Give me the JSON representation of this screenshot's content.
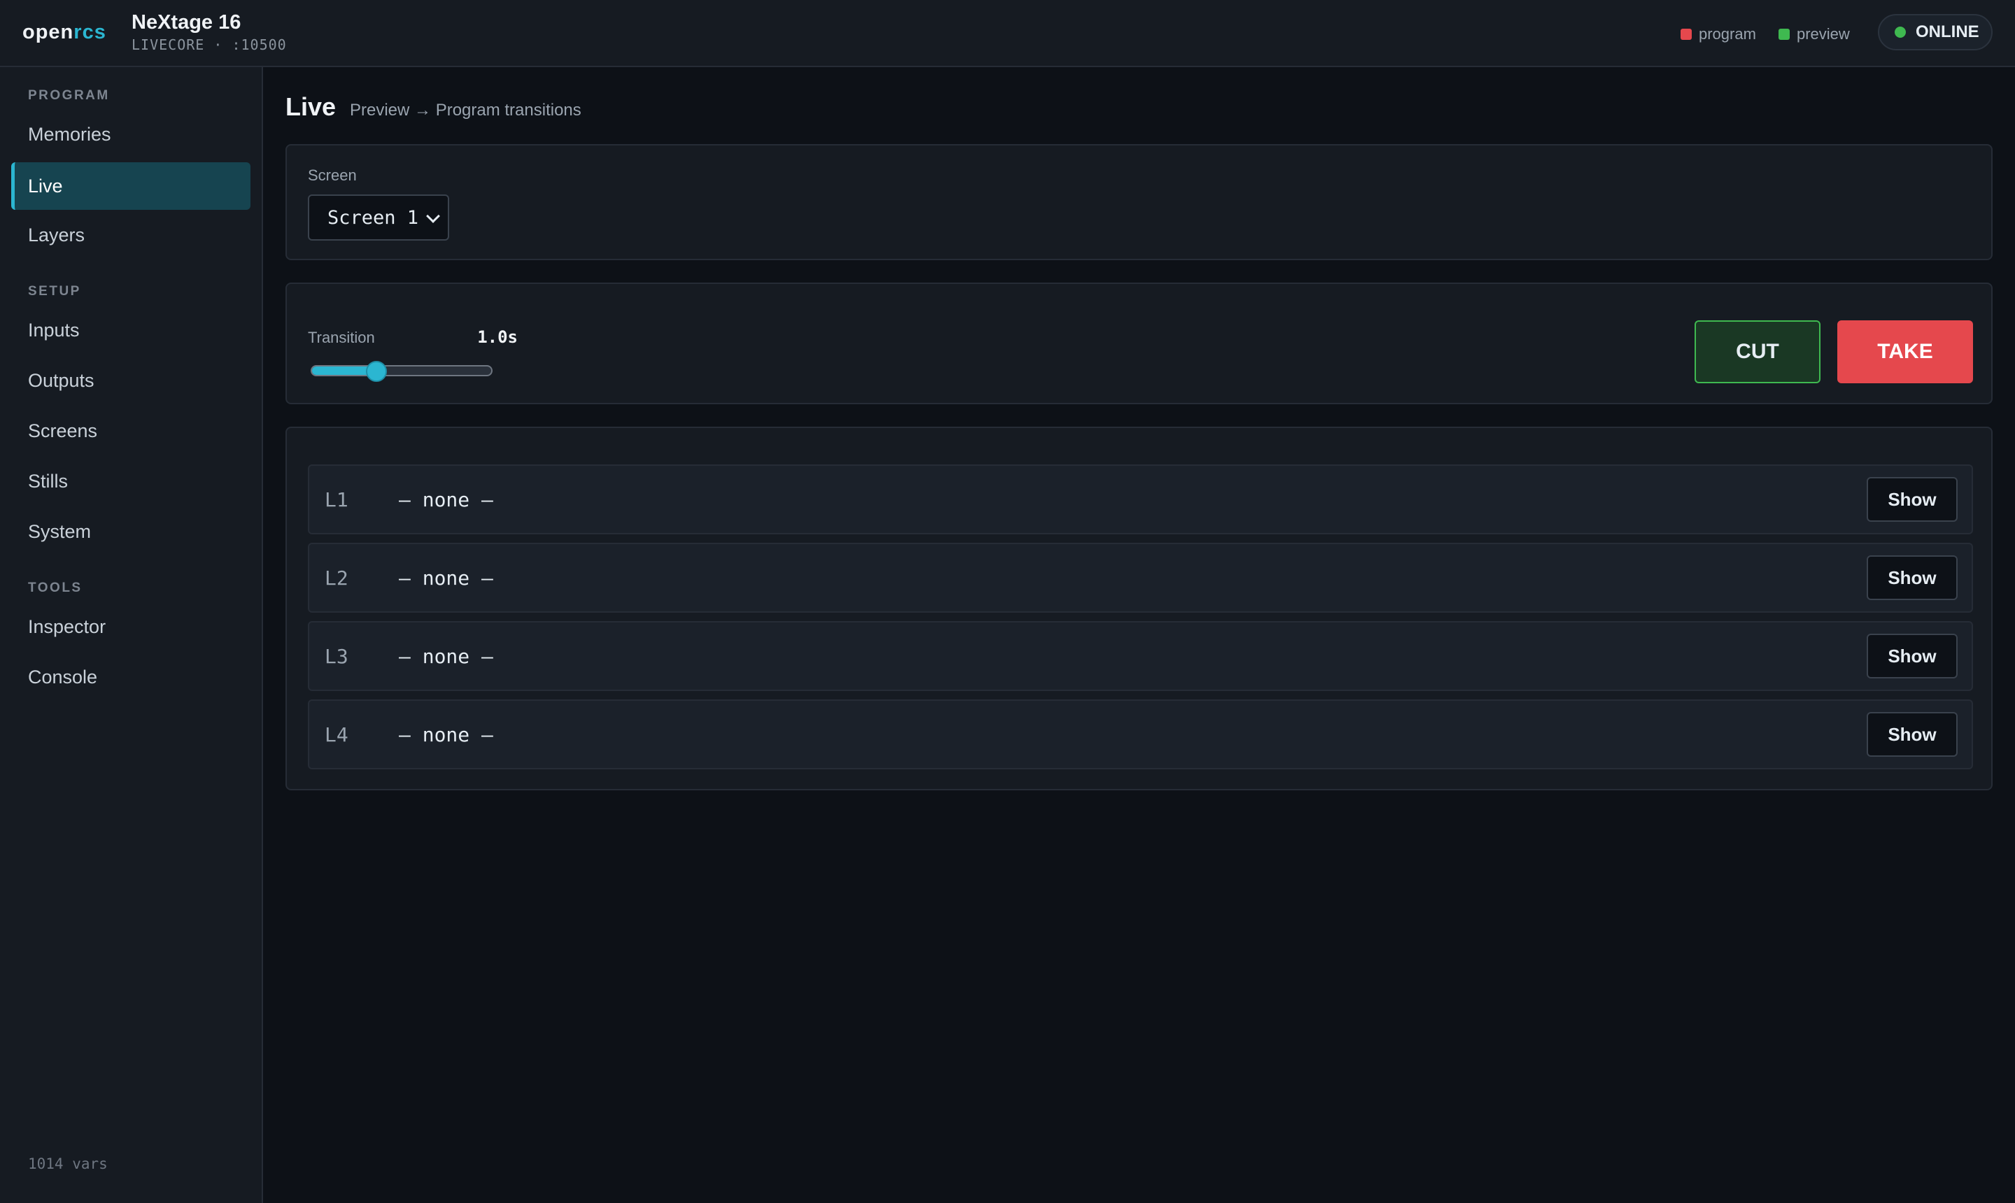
{
  "brand": {
    "part1": "open",
    "part2": "rcs"
  },
  "device": {
    "name": "NeXtage 16",
    "sub": "LIVECORE · :10500"
  },
  "legend": {
    "program": {
      "label": "program",
      "color": "#e5484d"
    },
    "preview": {
      "label": "preview",
      "color": "#3fb950"
    }
  },
  "status": {
    "label": "ONLINE",
    "color": "#3fb950"
  },
  "sidebar": {
    "sections": [
      {
        "label": "PROGRAM",
        "items": [
          "Memories",
          "Live",
          "Layers"
        ]
      },
      {
        "label": "SETUP",
        "items": [
          "Inputs",
          "Outputs",
          "Screens",
          "Stills",
          "System"
        ]
      },
      {
        "label": "TOOLS",
        "items": [
          "Inspector",
          "Console"
        ]
      }
    ],
    "active": "Live",
    "footer": "1014 vars"
  },
  "page": {
    "title": "Live",
    "subtitle": "Preview → Program transitions"
  },
  "screen": {
    "label": "Screen",
    "selected": "Screen 1"
  },
  "transition": {
    "label": "Transition",
    "value": "1.0s",
    "slider_fraction": 0.36
  },
  "actions": {
    "cut": "CUT",
    "take": "TAKE"
  },
  "layers": [
    {
      "id": "L1",
      "value": "— none —",
      "button": "Show"
    },
    {
      "id": "L2",
      "value": "— none —",
      "button": "Show"
    },
    {
      "id": "L3",
      "value": "— none —",
      "button": "Show"
    },
    {
      "id": "L4",
      "value": "— none —",
      "button": "Show"
    }
  ]
}
